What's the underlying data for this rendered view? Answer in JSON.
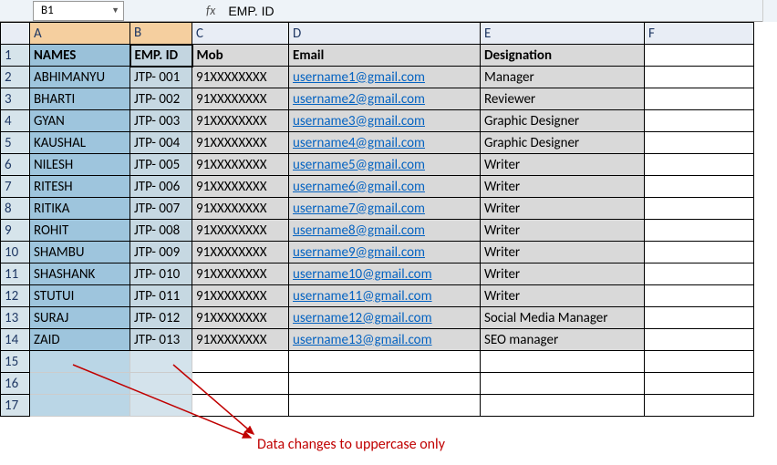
{
  "nameBox": "B1",
  "formulaBar": "EMP. ID",
  "fxLabel": "fx",
  "columns": [
    "A",
    "B",
    "C",
    "D",
    "E",
    "F"
  ],
  "headers": {
    "A": "NAMES",
    "B": "EMP. ID",
    "C": "Mob",
    "D": "Email",
    "E": "Designation"
  },
  "rows": [
    {
      "name": "ABHIMANYU",
      "emp": "JTP- 001",
      "mob": "91XXXXXXXX",
      "email": "username1@gmail.com",
      "desig": "Manager"
    },
    {
      "name": "BHARTI",
      "emp": "JTP- 002",
      "mob": "91XXXXXXXX",
      "email": "username2@gmail.com",
      "desig": "Reviewer"
    },
    {
      "name": "GYAN",
      "emp": "JTP- 003",
      "mob": "91XXXXXXXX",
      "email": "username3@gmail.com",
      "desig": "Graphic Designer"
    },
    {
      "name": "KAUSHAL",
      "emp": "JTP- 004",
      "mob": "91XXXXXXXX",
      "email": "username4@gmail.com",
      "desig": "Graphic Designer"
    },
    {
      "name": "NILESH",
      "emp": "JTP- 005",
      "mob": "91XXXXXXXX",
      "email": "username5@gmail.com",
      "desig": "Writer"
    },
    {
      "name": "RITESH",
      "emp": "JTP- 006",
      "mob": "91XXXXXXXX",
      "email": "username6@gmail.com",
      "desig": "Writer"
    },
    {
      "name": "RITIKA",
      "emp": "JTP- 007",
      "mob": "91XXXXXXXX",
      "email": "username7@gmail.com",
      "desig": "Writer"
    },
    {
      "name": "ROHIT",
      "emp": "JTP- 008",
      "mob": "91XXXXXXXX",
      "email": "username8@gmail.com",
      "desig": "Writer"
    },
    {
      "name": "SHAMBU",
      "emp": "JTP- 009",
      "mob": "91XXXXXXXX",
      "email": "username9@gmail.com",
      "desig": "Writer"
    },
    {
      "name": "SHASHANK",
      "emp": "JTP- 010",
      "mob": "91XXXXXXXX",
      "email": "username10@gmail.com",
      "desig": "Writer"
    },
    {
      "name": "STUTUI",
      "emp": "JTP- 011",
      "mob": "91XXXXXXXX",
      "email": "username11@gmail.com",
      "desig": "Writer"
    },
    {
      "name": "SURAJ",
      "emp": "JTP- 012",
      "mob": "91XXXXXXXX",
      "email": "username12@gmail.com",
      "desig": "Social Media Manager"
    },
    {
      "name": "ZAID",
      "emp": "JTP- 013",
      "mob": "91XXXXXXXX",
      "email": "username13@gmail.com",
      "desig": "SEO manager"
    }
  ],
  "emptyRows": [
    15,
    16,
    17
  ],
  "annotation": "Data changes to uppercase only",
  "selection": {
    "activeCell": "B1",
    "columnsHighlighted": [
      "A",
      "B"
    ]
  },
  "chart_data": {
    "type": "table",
    "title": "",
    "columns": [
      "NAMES",
      "EMP. ID",
      "Mob",
      "Email",
      "Designation"
    ],
    "data": [
      [
        "ABHIMANYU",
        "JTP- 001",
        "91XXXXXXXX",
        "username1@gmail.com",
        "Manager"
      ],
      [
        "BHARTI",
        "JTP- 002",
        "91XXXXXXXX",
        "username2@gmail.com",
        "Reviewer"
      ],
      [
        "GYAN",
        "JTP- 003",
        "91XXXXXXXX",
        "username3@gmail.com",
        "Graphic Designer"
      ],
      [
        "KAUSHAL",
        "JTP- 004",
        "91XXXXXXXX",
        "username4@gmail.com",
        "Graphic Designer"
      ],
      [
        "NILESH",
        "JTP- 005",
        "91XXXXXXXX",
        "username5@gmail.com",
        "Writer"
      ],
      [
        "RITESH",
        "JTP- 006",
        "91XXXXXXXX",
        "username6@gmail.com",
        "Writer"
      ],
      [
        "RITIKA",
        "JTP- 007",
        "91XXXXXXXX",
        "username7@gmail.com",
        "Writer"
      ],
      [
        "ROHIT",
        "JTP- 008",
        "91XXXXXXXX",
        "username8@gmail.com",
        "Writer"
      ],
      [
        "SHAMBU",
        "JTP- 009",
        "91XXXXXXXX",
        "username9@gmail.com",
        "Writer"
      ],
      [
        "SHASHANK",
        "JTP- 010",
        "91XXXXXXXX",
        "username10@gmail.com",
        "Writer"
      ],
      [
        "STUTUI",
        "JTP- 011",
        "91XXXXXXXX",
        "username11@gmail.com",
        "Writer"
      ],
      [
        "SURAJ",
        "JTP- 012",
        "91XXXXXXXX",
        "username12@gmail.com",
        "Social Media Manager"
      ],
      [
        "ZAID",
        "JTP- 013",
        "91XXXXXXXX",
        "username13@gmail.com",
        "SEO manager"
      ]
    ]
  }
}
